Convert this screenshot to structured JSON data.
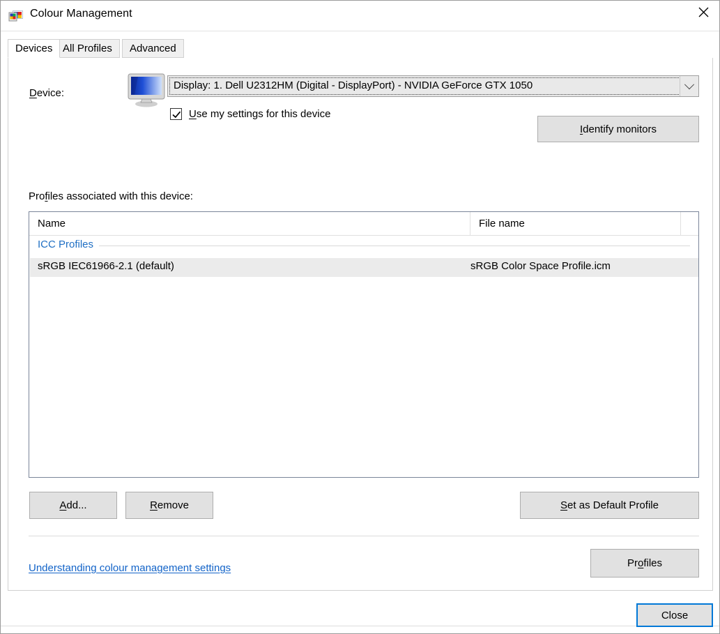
{
  "window": {
    "title": "Colour Management",
    "icon": "colour-management-icon",
    "close_icon": "close-icon"
  },
  "tabs": [
    {
      "label": "Devices",
      "active": true
    },
    {
      "label": "All Profiles",
      "active": false
    },
    {
      "label": "Advanced",
      "active": false
    }
  ],
  "device_section": {
    "label": "Device:",
    "label_accel": "D",
    "icon": "monitor-icon",
    "combo_value": "Display: 1. Dell U2312HM (Digital - DisplayPort) - NVIDIA GeForce GTX 1050",
    "combo_arrow_icon": "chevron-down-icon",
    "checkbox_label": "Use my settings for this device",
    "checkbox_accel": "U",
    "checkbox_checked": true,
    "identify_button": "Identify monitors",
    "identify_accel": "I"
  },
  "profiles_section": {
    "label": "Profiles associated with this device:",
    "label_accel": "f",
    "columns": [
      {
        "header": "Name"
      },
      {
        "header": "File name"
      },
      {
        "header": ""
      }
    ],
    "group_header": "ICC Profiles",
    "rows": [
      {
        "name": "sRGB IEC61966-2.1 (default)",
        "file_name": "sRGB Color Space Profile.icm",
        "selected": true
      }
    ]
  },
  "profile_buttons": {
    "add": "Add...",
    "add_accel": "A",
    "remove": "Remove",
    "remove_accel": "R",
    "set_default": "Set as Default Profile",
    "set_default_accel": "S"
  },
  "bottom": {
    "link": "Understanding colour management settings",
    "profiles_button": "Profiles",
    "profiles_accel": "o"
  },
  "footer": {
    "close_button": "Close"
  },
  "colors": {
    "accent": "#0078d7",
    "link": "#1263c8",
    "group_header": "#1f6fc4",
    "button_face": "#e1e1e1",
    "selected_row": "#ebebeb"
  }
}
